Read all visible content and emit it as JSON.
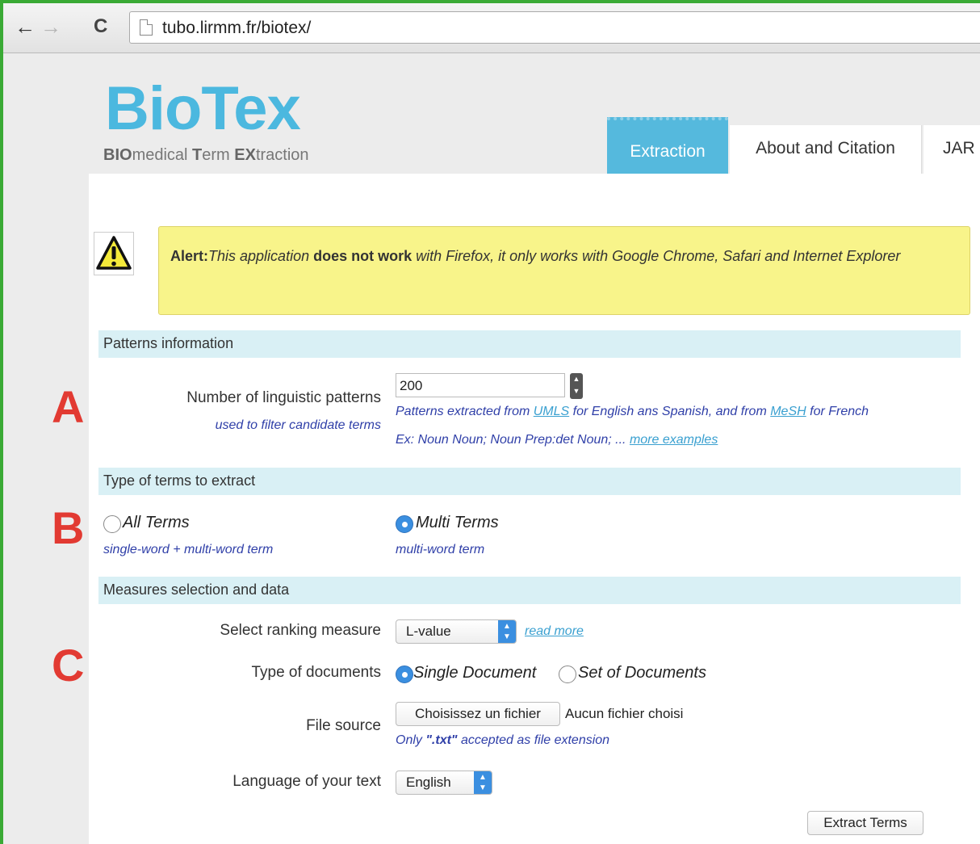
{
  "browser": {
    "back_symbol": "←",
    "forward_symbol": "→",
    "reload_symbol": "C",
    "url": "tubo.lirmm.fr/biotex/"
  },
  "site": {
    "logo": "BioTex",
    "tagline_parts": [
      "BIO",
      "medical ",
      "T",
      "erm ",
      "EX",
      "traction"
    ]
  },
  "tabs": [
    {
      "label": "Extraction",
      "active": true
    },
    {
      "label": "About and Citation",
      "active": false
    },
    {
      "label": "JAR",
      "active": false
    }
  ],
  "alert": {
    "icon": "warning-icon",
    "prefix": "Alert:",
    "text_1": "This application ",
    "strong": "does not work",
    "text_2": " with Firefox, it only works with Google Chrome, Safari and Internet Explorer"
  },
  "sections": {
    "patterns": "Patterns information",
    "type_terms": "Type of terms to extract",
    "measures": "Measures selection and data"
  },
  "annotations": {
    "a": "A",
    "b": "B",
    "c": "C"
  },
  "patterns": {
    "label": "Number of linguistic patterns",
    "sub_label": "used to filter candidate terms",
    "value": "200",
    "hint_1": "Patterns extracted from ",
    "hint_link_1": "UMLS",
    "hint_2": " for English ans Spanish, and from ",
    "hint_link_2": "MeSH",
    "hint_3": " for French",
    "example": "Ex: Noun Noun; Noun Prep:det Noun; ... ",
    "example_link": "more examples"
  },
  "term_types": [
    {
      "label": "All Terms",
      "hint": "single-word + multi-word term",
      "selected": false
    },
    {
      "label": "Multi Terms",
      "hint": "multi-word term",
      "selected": true
    }
  ],
  "measures": {
    "ranking_label": "Select ranking measure",
    "ranking_value": "L-value",
    "read_more": "read more",
    "doc_type_label": "Type of documents",
    "doc_types": [
      {
        "label": "Single Document",
        "selected": true
      },
      {
        "label": "Set of Documents",
        "selected": false
      }
    ],
    "file_label": "File source",
    "file_button": "Choisissez un fichier",
    "file_status": "Aucun fichier choisi",
    "file_hint_1": "Only ",
    "file_hint_ext": "\".txt\"",
    "file_hint_2": " accepted as file extension",
    "language_label": "Language of your text",
    "language_value": "English",
    "submit": "Extract Terms"
  }
}
